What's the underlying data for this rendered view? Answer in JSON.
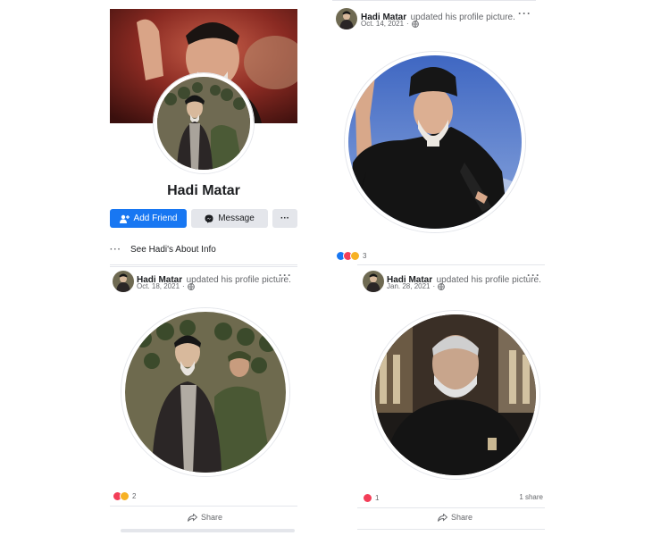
{
  "profile": {
    "name": "Hadi Matar",
    "add_friend": "Add Friend",
    "message": "Message",
    "more": "···",
    "about_dots": "···",
    "about_link": "See Hadi's About Info"
  },
  "posts": [
    {
      "author": "Hadi Matar",
      "action": "updated his profile picture.",
      "date": "Oct. 14, 2021",
      "reaction_count": "3",
      "shares": "",
      "share_label": ""
    },
    {
      "author": "Hadi Matar",
      "action": "updated his profile picture.",
      "date": "Oct. 18, 2021",
      "reaction_count": "2",
      "shares": "",
      "share_label": "Share"
    },
    {
      "author": "Hadi Matar",
      "action": "updated his profile picture.",
      "date": "Jan. 28, 2021",
      "reaction_count": "1",
      "shares": "1 share",
      "share_label": "Share"
    }
  ],
  "post_menu": "···",
  "colors": {
    "facebook_blue": "#1877f2",
    "button_gray": "#e4e6eb",
    "muted_text": "#65676b",
    "like_blue": "#1877f2",
    "love_red": "#f33e58",
    "haha_yellow": "#f7b125"
  },
  "icons": [
    "add-person-icon",
    "messenger-icon",
    "globe-icon",
    "share-arrow-icon",
    "like-icon",
    "love-icon",
    "care-icon"
  ]
}
